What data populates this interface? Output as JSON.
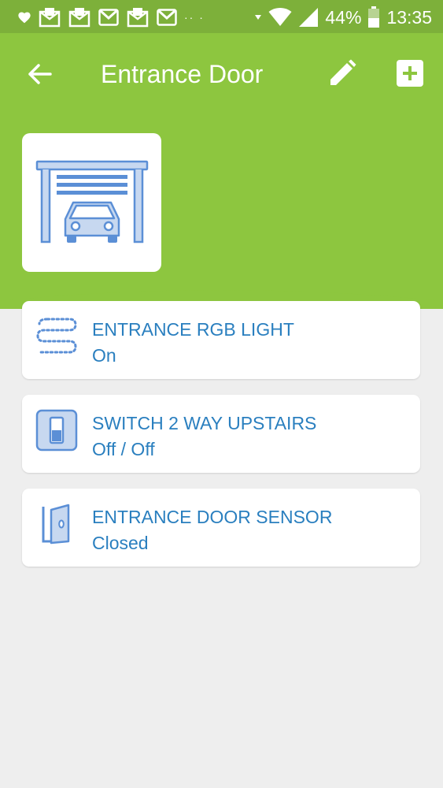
{
  "status_bar": {
    "battery_text": "44%",
    "time": "13:35",
    "dots": "··  ·",
    "icons": [
      "heart-icon",
      "mail-icon",
      "mail-icon",
      "gmail-icon",
      "mail-icon",
      "gmail-icon",
      "vibrate-icon",
      "wifi-icon",
      "signal-icon",
      "battery-icon"
    ]
  },
  "header": {
    "title": "Entrance Door",
    "back_icon": "arrow-left-icon",
    "edit_icon": "pencil-icon",
    "add_icon": "add-box-icon",
    "room_image_icon": "garage-car-icon"
  },
  "devices": [
    {
      "name": "ENTRANCE RGB LIGHT",
      "state": "On",
      "icon": "led-strip-icon"
    },
    {
      "name": "SWITCH 2 WAY UPSTAIRS",
      "state": "Off / Off",
      "icon": "wall-switch-icon"
    },
    {
      "name": "ENTRANCE DOOR SENSOR",
      "state": "Closed",
      "icon": "door-icon"
    }
  ],
  "colors": {
    "header": "#8dc63f",
    "status_bar": "#7db03a",
    "device_text": "#2a7fbf",
    "icon_blue": "#5b8fd6",
    "background": "#eeeeee"
  }
}
